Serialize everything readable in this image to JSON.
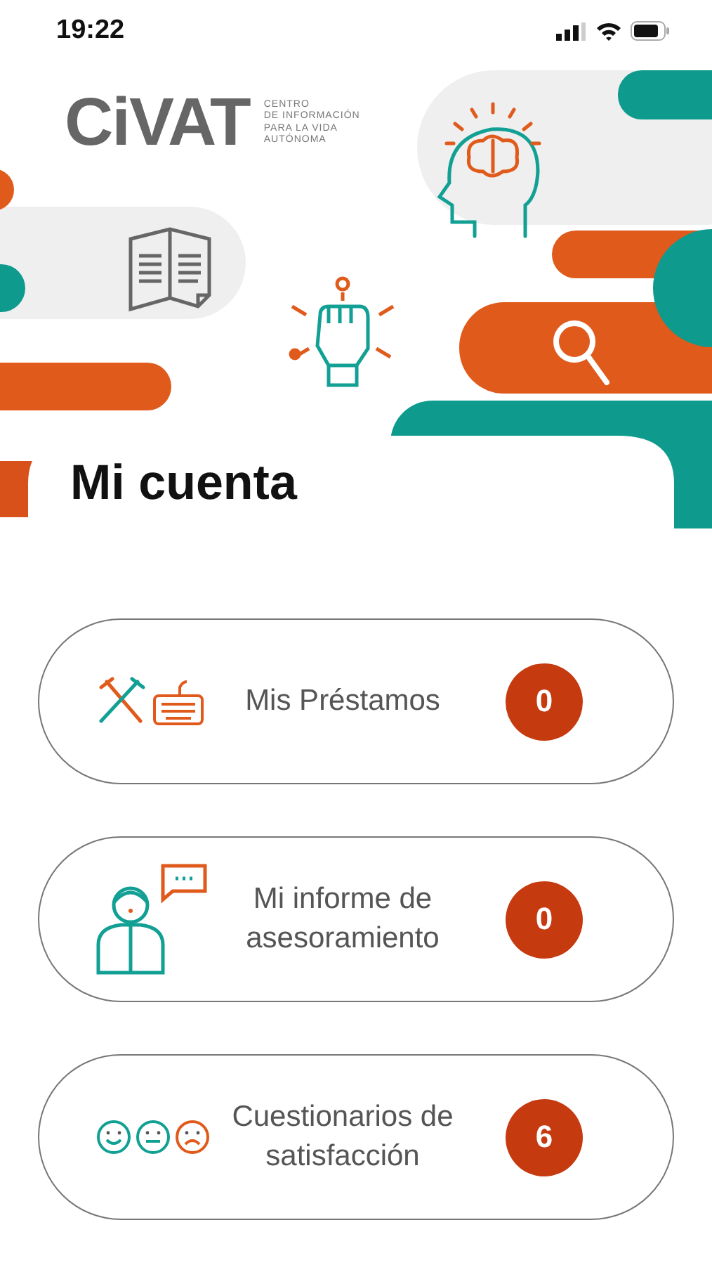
{
  "status_bar": {
    "time": "19:22"
  },
  "logo": {
    "name": "CiVAT",
    "tagline": [
      "CENTRO",
      "DE INFORMACIÓN",
      "PARA LA VIDA",
      "AUTÓNOMA"
    ]
  },
  "title": "Mi cuenta",
  "items": [
    {
      "kind": "loans",
      "label": "Mis Préstamos",
      "count": "0"
    },
    {
      "kind": "report",
      "label": "Mi informe de asesoramiento",
      "count": "0"
    },
    {
      "kind": "survey",
      "label": "Cuestionarios de satisfacción",
      "count": "6"
    }
  ]
}
